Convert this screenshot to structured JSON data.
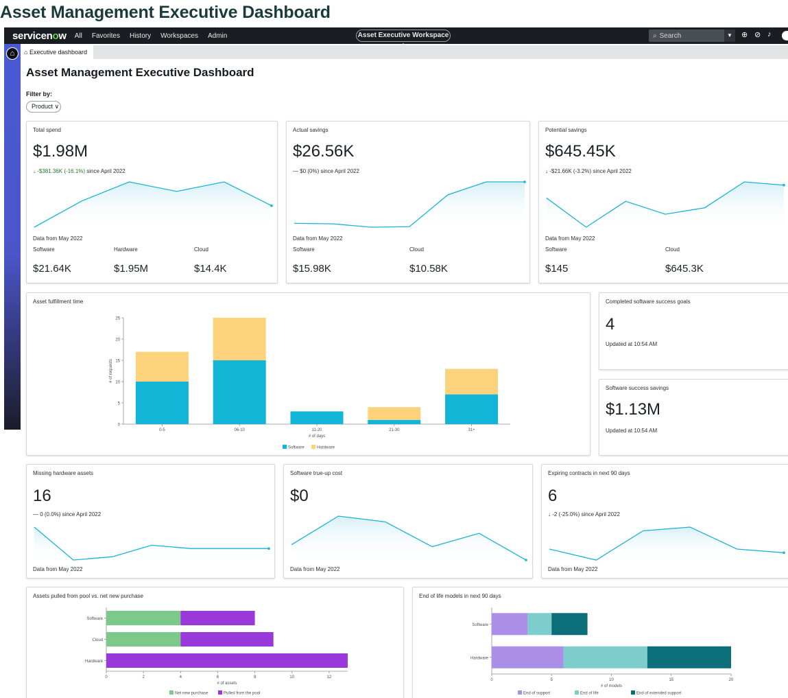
{
  "page_heading": "Asset Management Executive Dashboard",
  "topnav": {
    "logo_prefix": "servicen",
    "logo_o": "o",
    "logo_suffix": "w",
    "links": [
      "All",
      "Favorites",
      "History",
      "Workspaces",
      "Admin"
    ],
    "workspace": "Asset Executive Workspace ☆",
    "search_placeholder": "Search"
  },
  "tab": {
    "label": "Executive dashboard"
  },
  "dashboard": {
    "title": "Asset Management Executive Dashboard",
    "filter_label": "Filter by:",
    "filter_value": "Product"
  },
  "cards": {
    "total_spend": {
      "title": "Total spend",
      "value": "$1.98M",
      "delta_value": "↓ -$381.36K (-16.1%)",
      "delta_suffix": " since April 2022",
      "data_from": "Data from May 2022",
      "breakdown": [
        {
          "label": "Software",
          "value": "$21.64K"
        },
        {
          "label": "Hardware",
          "value": "$1.95M"
        },
        {
          "label": "Cloud",
          "value": "$14.4K"
        }
      ],
      "trend": [
        100,
        210,
        290,
        250,
        290,
        190
      ]
    },
    "actual_savings": {
      "title": "Actual savings",
      "value": "$26.56K",
      "delta": "— $0 (0%) since April 2022",
      "data_from": "Data from May 2022",
      "breakdown": [
        {
          "label": "Software",
          "value": "$15.98K"
        },
        {
          "label": "Cloud",
          "value": "$10.58K"
        }
      ],
      "trend": [
        140,
        138,
        125,
        127,
        250,
        300,
        300
      ]
    },
    "potential_savings": {
      "title": "Potential savings",
      "value": "$645.45K",
      "delta": "↓ -$21.66K (-3.2%) since April 2022",
      "data_from": "Data from May 2022",
      "breakdown": [
        {
          "label": "Software",
          "value": "$145"
        },
        {
          "label": "Cloud",
          "value": "$645.3K"
        }
      ],
      "trend": [
        240,
        150,
        230,
        190,
        210,
        290,
        280
      ]
    },
    "fulfillment": {
      "title": "Asset fulfillment time",
      "completed_title": "Completed software success goals",
      "completed_value": "4",
      "completed_note": "Updated at 10:54 AM",
      "savings_title": "Software success savings",
      "savings_value": "$1.13M",
      "savings_note": "Updated at 10:54 AM"
    },
    "missing_hw": {
      "title": "Missing hardware assets",
      "value": "16",
      "delta": "— 0 (0.0%) since April 2022",
      "data_from": "Data from May 2022",
      "trend": [
        28,
        8,
        10,
        17,
        15,
        15,
        15
      ]
    },
    "trueup": {
      "title": "Software true-up cost",
      "value": "$0",
      "data_from": "Data from May 2022",
      "trend": [
        10,
        25,
        22,
        9,
        16,
        2
      ]
    },
    "expiring": {
      "title": "Expiring contracts in next 90 days",
      "value": "6",
      "delta": "↓ -2 (-25.0%) since April 2022",
      "data_from": "Data from May 2022",
      "trend": [
        7,
        4,
        12,
        13,
        7,
        6
      ]
    },
    "pool": {
      "title": "Assets pulled from pool vs. net new purchase"
    },
    "eol": {
      "title": "End of life models in next 90 days"
    }
  },
  "chart_data": [
    {
      "type": "bar",
      "stacked": true,
      "categories": [
        "0-5",
        "06-10",
        "11-20",
        "21-30",
        "31+"
      ],
      "series": [
        {
          "name": "Software",
          "values": [
            10,
            15,
            3,
            1,
            7
          ],
          "color": "#13b5d6"
        },
        {
          "name": "Hardware",
          "values": [
            7,
            10,
            0,
            3,
            6
          ],
          "color": "#fdd27c"
        }
      ],
      "xlabel": "# of days",
      "ylabel": "# of requests",
      "ylim": [
        0,
        25
      ],
      "yticks": [
        0,
        5,
        10,
        15,
        20,
        25
      ],
      "legend": "bottom"
    },
    {
      "type": "bar",
      "orientation": "horizontal",
      "stacked": true,
      "categories": [
        "Software",
        "Cloud",
        "Hardware"
      ],
      "series": [
        {
          "name": "Net new purchase",
          "values": [
            4,
            4,
            0
          ],
          "color": "#7dc98a"
        },
        {
          "name": "Pulled from the pool",
          "values": [
            4,
            5,
            13
          ],
          "color": "#9939d9"
        }
      ],
      "xlabel": "# of assets",
      "xlim": [
        0,
        13
      ],
      "xticks": [
        0,
        2,
        4,
        6,
        8,
        10,
        12
      ],
      "legend": "bottom"
    },
    {
      "type": "bar",
      "orientation": "horizontal",
      "stacked": true,
      "categories": [
        "Software",
        "Hardware"
      ],
      "series": [
        {
          "name": "End of support",
          "values": [
            3,
            6
          ],
          "color": "#ab8ee8"
        },
        {
          "name": "End of life",
          "values": [
            2,
            7
          ],
          "color": "#7ccdcb"
        },
        {
          "name": "End of extended support",
          "values": [
            3,
            7
          ],
          "color": "#0c6e79"
        }
      ],
      "xlabel": "# of models",
      "xlim": [
        0,
        20
      ],
      "xticks": [
        0,
        5,
        10,
        15,
        20
      ],
      "legend": "bottom"
    }
  ]
}
